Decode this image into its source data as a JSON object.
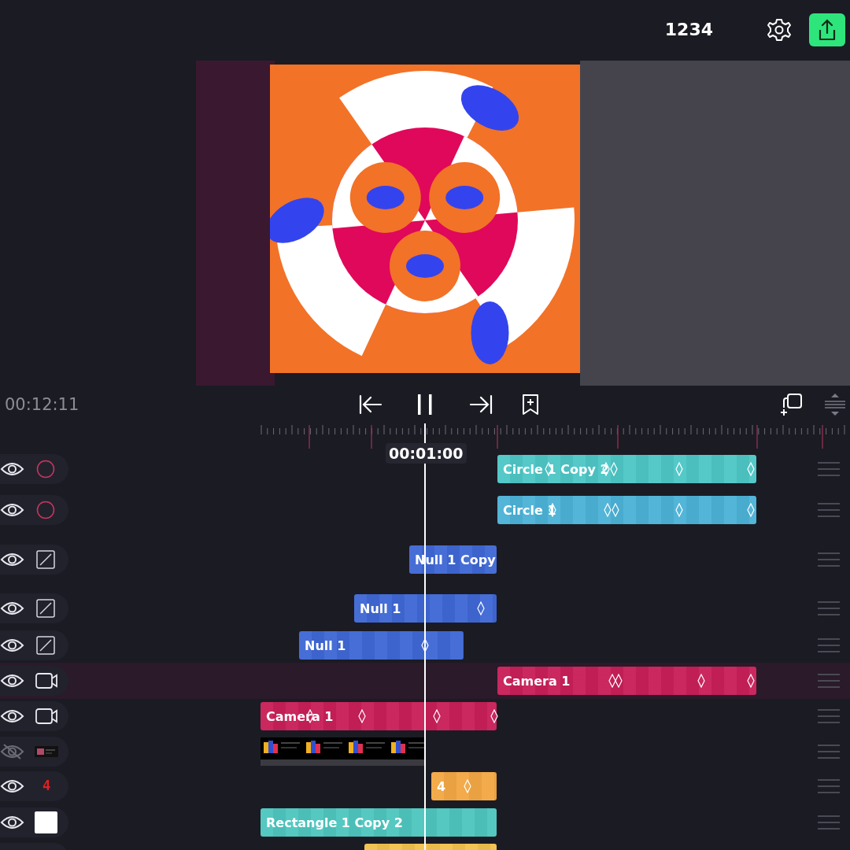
{
  "header": {
    "frame_label": "1234"
  },
  "transport": {
    "timecode": "00:12:11",
    "playing": true,
    "playhead_time": "00:01:00"
  },
  "tracks": [
    {
      "kind": "circle",
      "visible": true,
      "selected": false,
      "clip": {
        "kind": "layer",
        "label": "Circle 1 Copy 2",
        "color": "#4ec6c6"
      }
    },
    {
      "kind": "circle",
      "visible": true,
      "selected": false,
      "clip": {
        "kind": "layer",
        "label": "Circle 1",
        "color": "#4cb2d6"
      }
    },
    {
      "kind": "null",
      "visible": true,
      "selected": false,
      "clip": {
        "kind": "layer",
        "label": "Null 1 Copy",
        "color": "#3f68d4"
      }
    },
    {
      "kind": "null",
      "visible": true,
      "selected": false,
      "clip": {
        "kind": "layer",
        "label": "Null 1",
        "color": "#3f68d4"
      }
    },
    {
      "kind": "null",
      "visible": true,
      "selected": false,
      "clip": {
        "kind": "layer",
        "label": "Null 1",
        "color": "#3f68d4"
      }
    },
    {
      "kind": "camera",
      "visible": true,
      "selected": true,
      "clip": {
        "kind": "layer",
        "label": "Camera 1",
        "color": "#c81f58"
      }
    },
    {
      "kind": "camera",
      "visible": true,
      "selected": false,
      "clip": {
        "kind": "layer",
        "label": "Camera 1",
        "color": "#c81f58"
      }
    },
    {
      "kind": "video",
      "visible": false,
      "selected": false,
      "clip": {
        "kind": "video"
      }
    },
    {
      "kind": "text",
      "icon_text": "4",
      "visible": true,
      "selected": false,
      "clip": {
        "kind": "layer",
        "label": "4",
        "color": "#f2a844"
      }
    },
    {
      "kind": "rectangle",
      "visible": true,
      "selected": false,
      "clip": {
        "kind": "layer",
        "label": "Rectangle 1 Copy 2",
        "color": "#4ec6be"
      }
    },
    {
      "kind": "partial",
      "clip": {
        "kind": "layer",
        "color": "#f2c24e"
      }
    }
  ]
}
